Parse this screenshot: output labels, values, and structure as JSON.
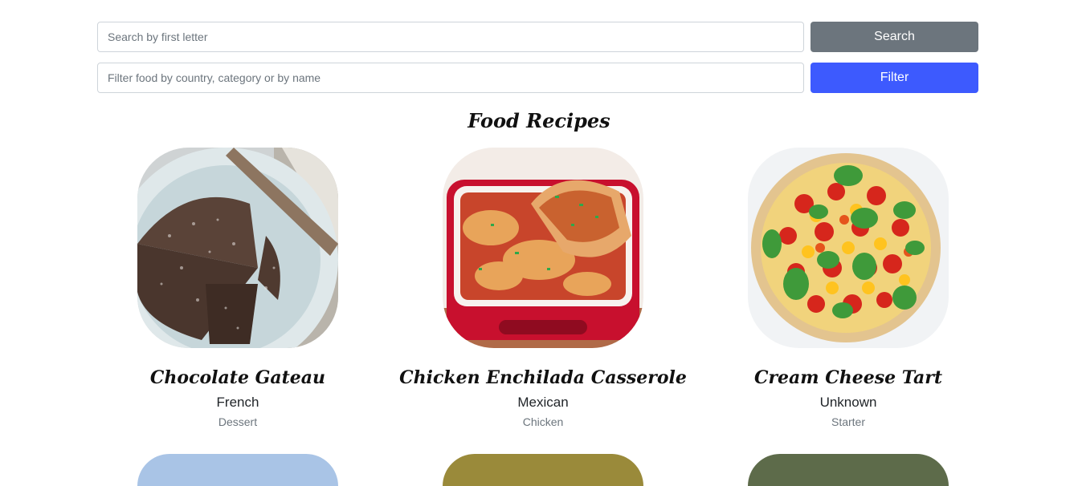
{
  "search": {
    "letter_placeholder": "Search by first letter",
    "letter_value": "",
    "search_label": "Search",
    "filter_placeholder": "Filter food by country, category or by name",
    "filter_value": "",
    "filter_label": "Filter"
  },
  "page": {
    "title": "Food Recipes"
  },
  "recipes": [
    {
      "name": "Chocolate Gateau",
      "area": "French",
      "category": "Dessert"
    },
    {
      "name": "Chicken Enchilada Casserole",
      "area": "Mexican",
      "category": "Chicken"
    },
    {
      "name": "Cream Cheese Tart",
      "area": "Unknown",
      "category": "Starter"
    }
  ],
  "colors": {
    "search_button": "#6c757d",
    "filter_button": "#3d5afe"
  }
}
